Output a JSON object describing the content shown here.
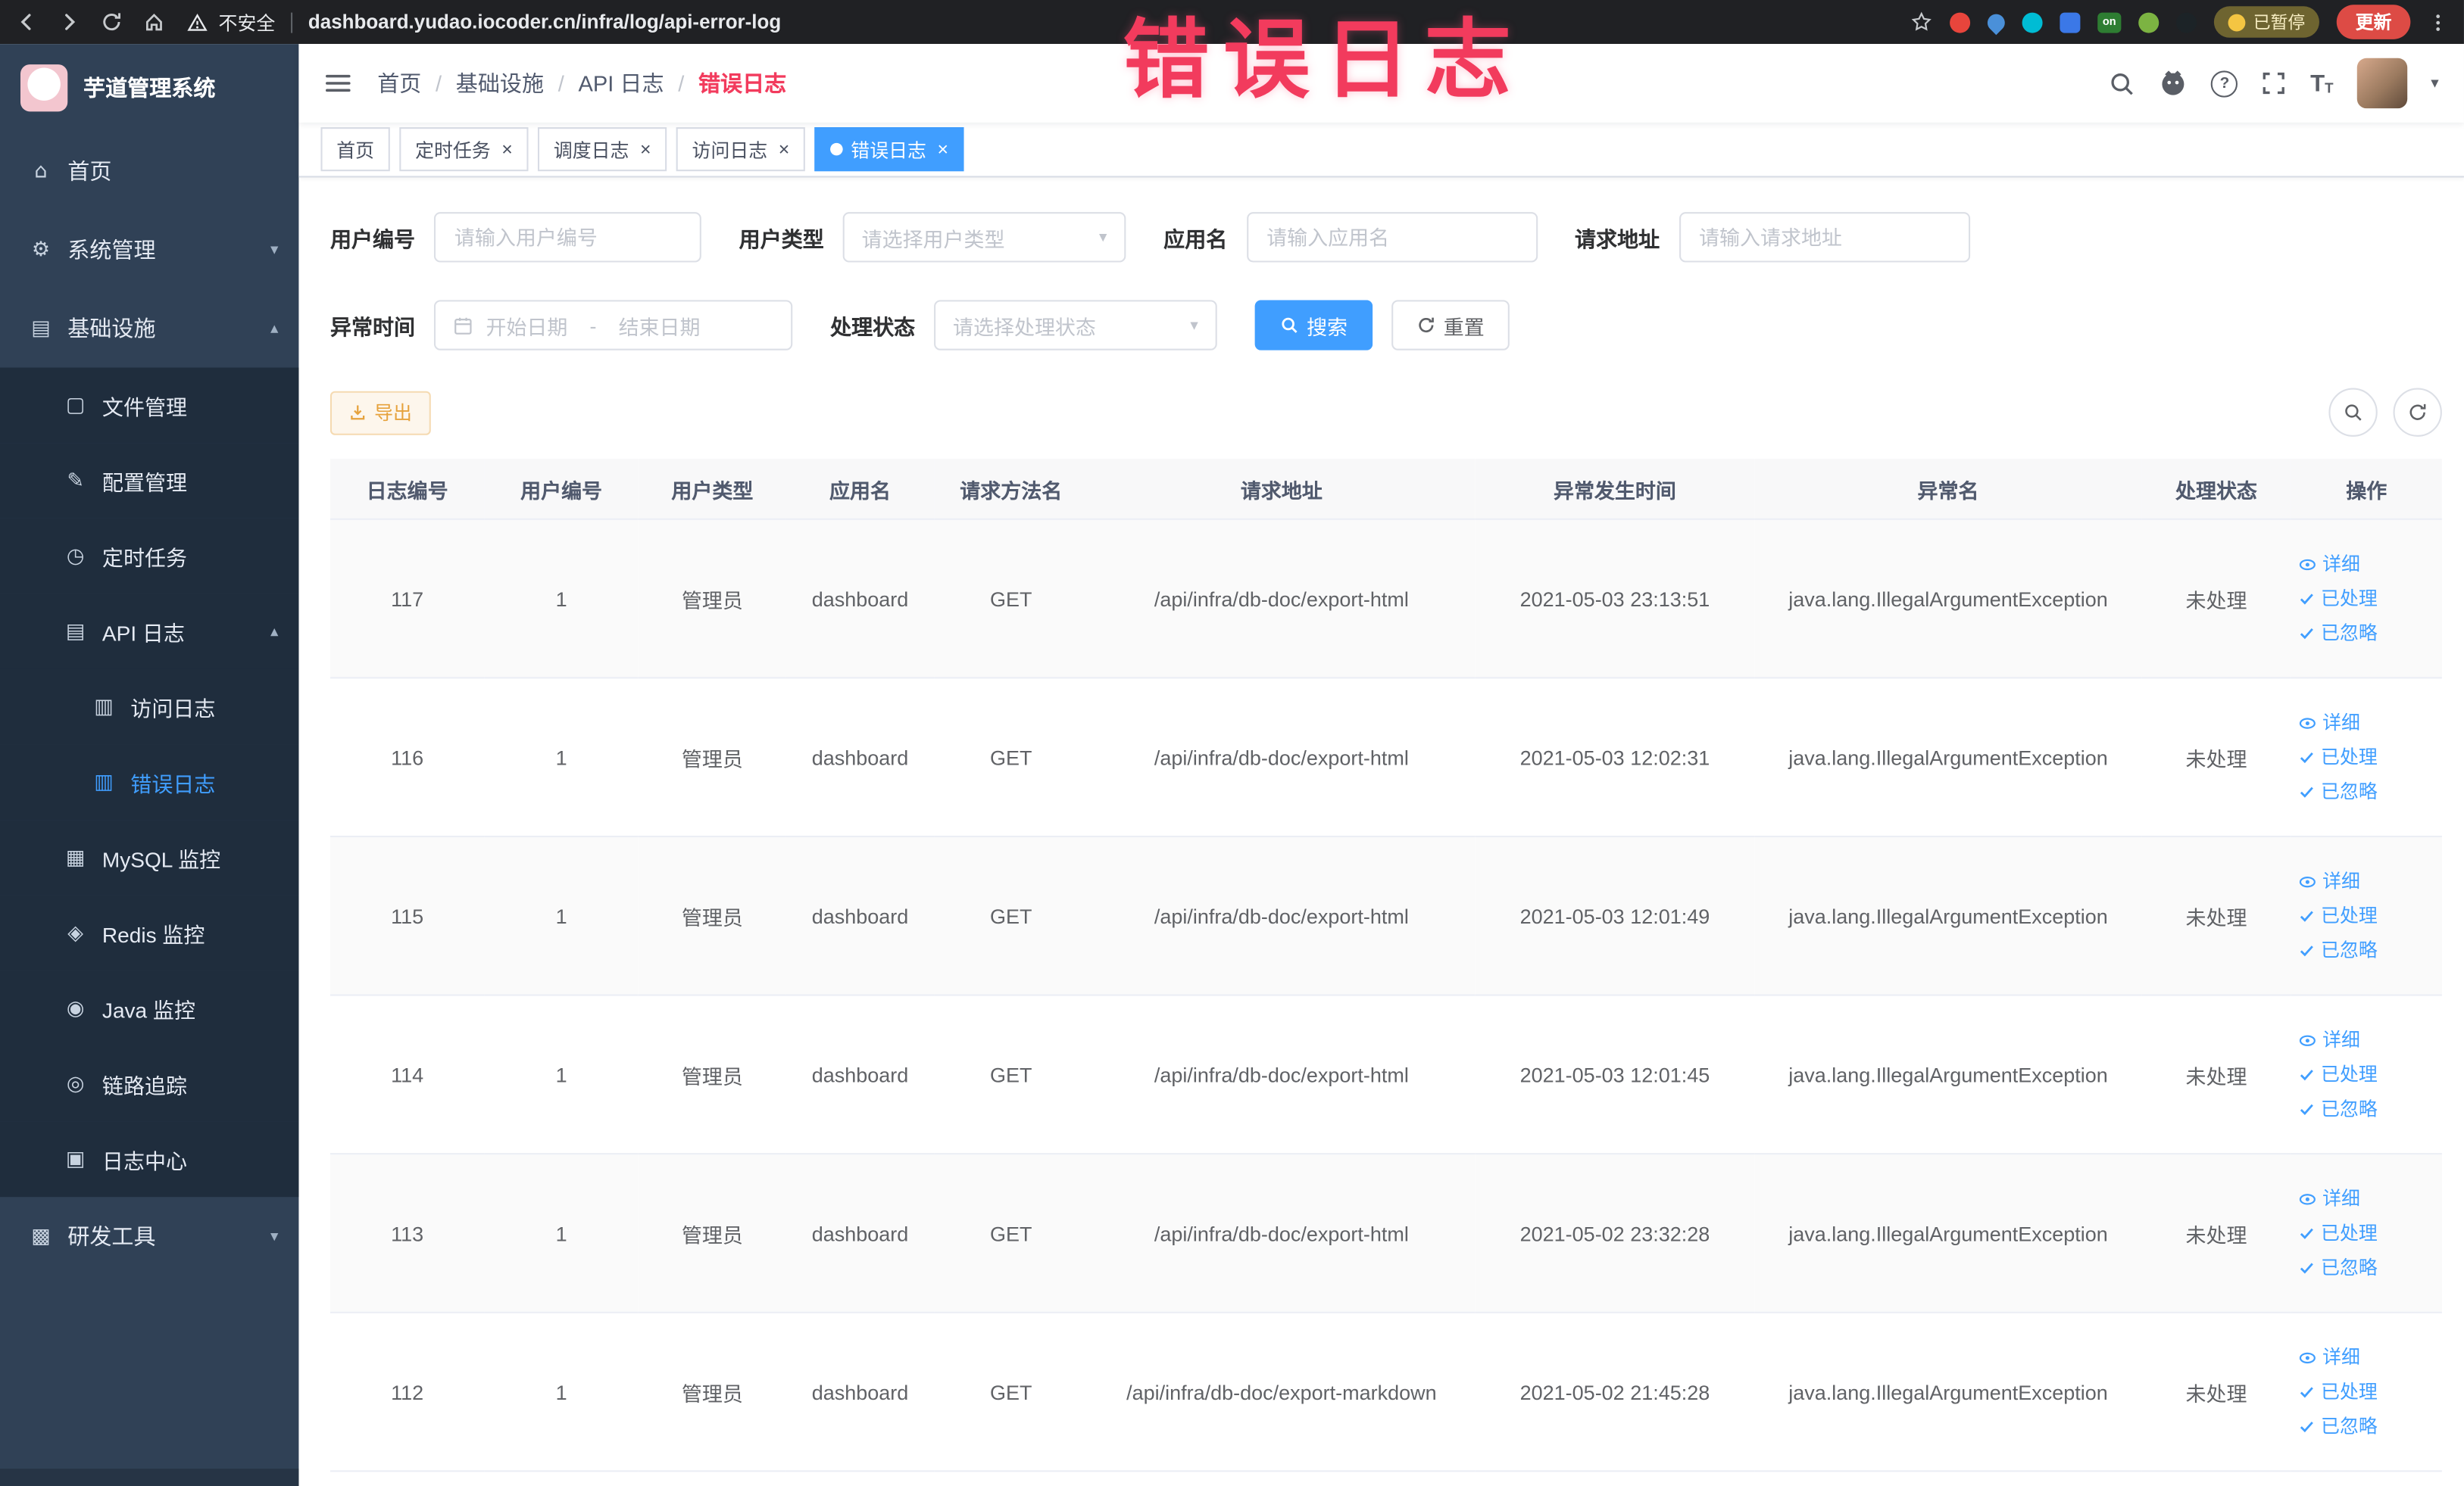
{
  "annotation": {
    "text": "错误日志"
  },
  "browser": {
    "security_label": "不安全",
    "url": "dashboard.yudao.iocoder.cn/infra/log/api-error-log",
    "paused_badge": "已暂停",
    "update_button": "更新"
  },
  "sidebar": {
    "app_title": "芋道管理系统",
    "items": [
      {
        "key": "home",
        "label": "首页",
        "icon": "home",
        "level": 0
      },
      {
        "key": "system-mgmt",
        "label": "系统管理",
        "icon": "gear",
        "level": 0,
        "chevron": "down"
      },
      {
        "key": "infrastructure",
        "label": "基础设施",
        "icon": "infra",
        "level": 0,
        "chevron": "up"
      },
      {
        "key": "file-mgmt",
        "label": "文件管理",
        "icon": "file",
        "level": 1
      },
      {
        "key": "config-mgmt",
        "label": "配置管理",
        "icon": "config",
        "level": 1
      },
      {
        "key": "scheduled-tasks",
        "label": "定时任务",
        "icon": "timer",
        "level": 1
      },
      {
        "key": "api-logs",
        "label": "API 日志",
        "icon": "api-log",
        "level": 1,
        "chevron": "up"
      },
      {
        "key": "access-log",
        "label": "访问日志",
        "icon": "doc",
        "level": 2
      },
      {
        "key": "error-log",
        "label": "错误日志",
        "icon": "doc",
        "level": 2,
        "active": true
      },
      {
        "key": "mysql-monitor",
        "label": "MySQL 监控",
        "icon": "mysql",
        "level": 1
      },
      {
        "key": "redis-monitor",
        "label": "Redis 监控",
        "icon": "redis",
        "level": 1
      },
      {
        "key": "java-monitor",
        "label": "Java 监控",
        "icon": "java",
        "level": 1
      },
      {
        "key": "trace",
        "label": "链路追踪",
        "icon": "trace",
        "level": 1
      },
      {
        "key": "log-center",
        "label": "日志中心",
        "icon": "log",
        "level": 1
      },
      {
        "key": "dev-tools",
        "label": "研发工具",
        "icon": "tools",
        "level": 0,
        "chevron": "down"
      }
    ]
  },
  "navbar": {
    "breadcrumb": [
      "首页",
      "基础设施",
      "API 日志",
      "错误日志"
    ]
  },
  "tabs": [
    {
      "key": "home",
      "label": "首页",
      "closable": false,
      "active": false
    },
    {
      "key": "scheduled-tasks",
      "label": "定时任务",
      "closable": true,
      "active": false
    },
    {
      "key": "scheduler-log",
      "label": "调度日志",
      "closable": true,
      "active": false
    },
    {
      "key": "access-log",
      "label": "访问日志",
      "closable": true,
      "active": false
    },
    {
      "key": "error-log",
      "label": "错误日志",
      "closable": true,
      "active": true
    }
  ],
  "filters": {
    "user_id": {
      "label": "用户编号",
      "placeholder": "请输入用户编号"
    },
    "user_type": {
      "label": "用户类型",
      "placeholder": "请选择用户类型"
    },
    "app_name": {
      "label": "应用名",
      "placeholder": "请输入应用名"
    },
    "request_url": {
      "label": "请求地址",
      "placeholder": "请输入请求地址"
    },
    "exception_time": {
      "label": "异常时间",
      "start_placeholder": "开始日期",
      "separator": "-",
      "end_placeholder": "结束日期"
    },
    "process_status": {
      "label": "处理状态",
      "placeholder": "请选择处理状态"
    },
    "search_label": "搜索",
    "reset_label": "重置"
  },
  "toolbar": {
    "export_label": "导出"
  },
  "table": {
    "headers": [
      "日志编号",
      "用户编号",
      "用户类型",
      "应用名",
      "请求方法名",
      "请求地址",
      "异常发生时间",
      "异常名",
      "处理状态",
      "操作"
    ],
    "actions": [
      {
        "key": "detail",
        "label": "详细"
      },
      {
        "key": "processed",
        "label": "已处理"
      },
      {
        "key": "ignored",
        "label": "已忽略"
      }
    ],
    "rows": [
      {
        "id": "117",
        "user_id": "1",
        "user_type": "管理员",
        "app_name": "dashboard",
        "method": "GET",
        "url": "/api/infra/db-doc/export-html",
        "time": "2021-05-03 23:13:51",
        "exception": "java.lang.IllegalArgumentException",
        "status": "未处理"
      },
      {
        "id": "116",
        "user_id": "1",
        "user_type": "管理员",
        "app_name": "dashboard",
        "method": "GET",
        "url": "/api/infra/db-doc/export-html",
        "time": "2021-05-03 12:02:31",
        "exception": "java.lang.IllegalArgumentException",
        "status": "未处理"
      },
      {
        "id": "115",
        "user_id": "1",
        "user_type": "管理员",
        "app_name": "dashboard",
        "method": "GET",
        "url": "/api/infra/db-doc/export-html",
        "time": "2021-05-03 12:01:49",
        "exception": "java.lang.IllegalArgumentException",
        "status": "未处理"
      },
      {
        "id": "114",
        "user_id": "1",
        "user_type": "管理员",
        "app_name": "dashboard",
        "method": "GET",
        "url": "/api/infra/db-doc/export-html",
        "time": "2021-05-03 12:01:45",
        "exception": "java.lang.IllegalArgumentException",
        "status": "未处理"
      },
      {
        "id": "113",
        "user_id": "1",
        "user_type": "管理员",
        "app_name": "dashboard",
        "method": "GET",
        "url": "/api/infra/db-doc/export-html",
        "time": "2021-05-02 23:32:28",
        "exception": "java.lang.IllegalArgumentException",
        "status": "未处理"
      },
      {
        "id": "112",
        "user_id": "1",
        "user_type": "管理员",
        "app_name": "dashboard",
        "method": "GET",
        "url": "/api/infra/db-doc/export-markdown",
        "time": "2021-05-02 21:45:28",
        "exception": "java.lang.IllegalArgumentException",
        "status": "未处理"
      }
    ]
  },
  "colors": {
    "accent": "#409eff",
    "annotation": "#f23b5d",
    "warning": "#e6a23c",
    "sidebar_bg": "#304156",
    "submenu_bg": "#1f2d3d"
  }
}
